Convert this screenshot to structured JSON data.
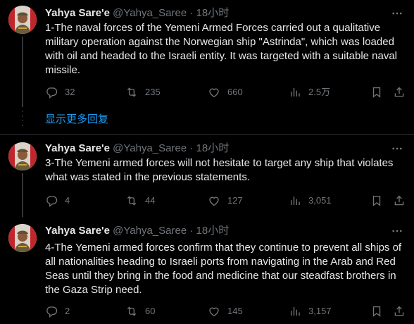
{
  "show_more_label": "显示更多回复",
  "tweets": [
    {
      "author_name": "Yahya Sare'e",
      "author_handle": "@Yahya_Saree",
      "separator": "·",
      "time": "18小时",
      "text": "1-The naval forces of the Yemeni Armed Forces carried out a qualitative military operation against the Norwegian ship \"Astrinda\", which was loaded with oil and headed to the Israeli entity. It was targeted with a suitable naval missile.",
      "replies": "32",
      "retweets": "235",
      "likes": "660",
      "views": "2.5万"
    },
    {
      "author_name": "Yahya Sare'e",
      "author_handle": "@Yahya_Saree",
      "separator": "·",
      "time": "18小时",
      "text": "3-The Yemeni armed forces will not hesitate to target any ship that violates what was stated in the previous statements.",
      "replies": "4",
      "retweets": "44",
      "likes": "127",
      "views": "3,051"
    },
    {
      "author_name": "Yahya Sare'e",
      "author_handle": "@Yahya_Saree",
      "separator": "·",
      "time": "18小时",
      "text": "4-The Yemeni armed forces confirm that they continue to prevent all ships of all nationalities heading to Israeli ports from navigating in the Arab and Red Seas until they bring in the food and medicine that our steadfast brothers in the Gaza Strip need.",
      "replies": "2",
      "retweets": "60",
      "likes": "145",
      "views": "3,157"
    }
  ],
  "colors": {
    "background": "#000000",
    "text": "#e7e9ea",
    "muted": "#71767b",
    "link": "#1d9bf0",
    "border": "#2f3336"
  },
  "icons": [
    "more-icon",
    "reply-icon",
    "retweet-icon",
    "like-icon",
    "views-icon",
    "bookmark-icon",
    "share-icon"
  ]
}
